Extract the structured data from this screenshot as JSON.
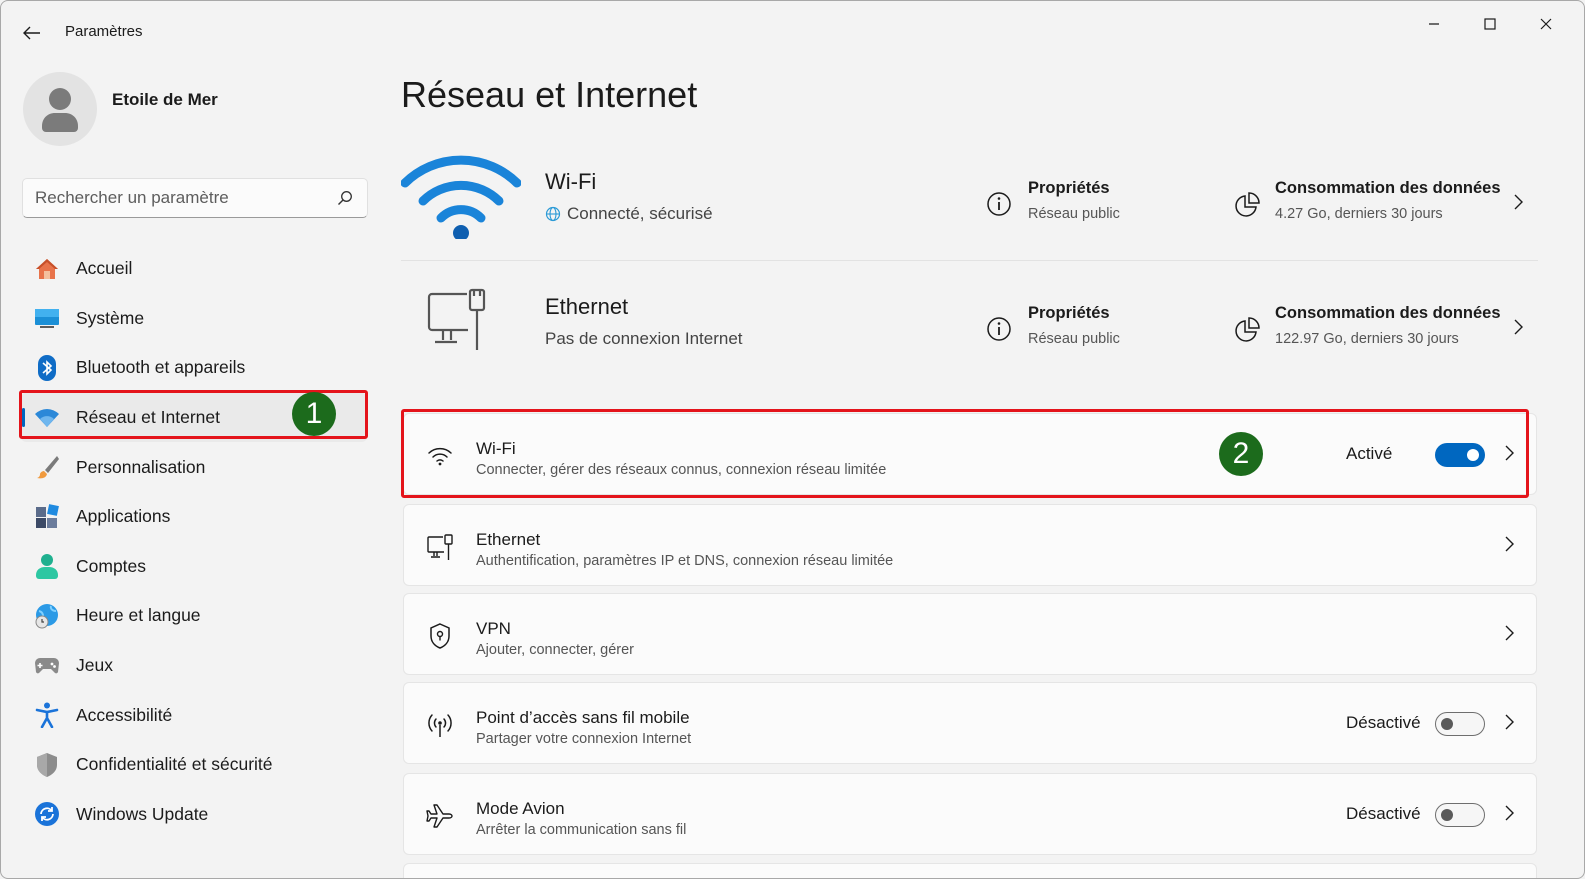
{
  "window": {
    "title": "Paramètres",
    "back_icon": "arrow-left-icon",
    "minimize_icon": "minimize-icon",
    "maximize_icon": "maximize-icon",
    "close_icon": "close-icon"
  },
  "user": {
    "name": "Etoile de Mer",
    "avatar_icon": "person-avatar-icon"
  },
  "search": {
    "placeholder": "Rechercher un paramètre",
    "value": "",
    "icon": "search-icon"
  },
  "sidebar": {
    "items": [
      {
        "label": "Accueil",
        "icon": "home-icon",
        "active": false
      },
      {
        "label": "Système",
        "icon": "system-display-icon",
        "active": false
      },
      {
        "label": "Bluetooth et appareils",
        "icon": "bluetooth-icon",
        "active": false
      },
      {
        "label": "Réseau et Internet",
        "icon": "wifi-icon",
        "active": true
      },
      {
        "label": "Personnalisation",
        "icon": "paintbrush-icon",
        "active": false
      },
      {
        "label": "Applications",
        "icon": "apps-icon",
        "active": false
      },
      {
        "label": "Comptes",
        "icon": "account-icon",
        "active": false
      },
      {
        "label": "Heure et langue",
        "icon": "globe-clock-icon",
        "active": false
      },
      {
        "label": "Jeux",
        "icon": "gamepad-icon",
        "active": false
      },
      {
        "label": "Accessibilité",
        "icon": "accessibility-icon",
        "active": false
      },
      {
        "label": "Confidentialité et sécurité",
        "icon": "shield-icon",
        "active": false
      },
      {
        "label": "Windows Update",
        "icon": "update-icon",
        "active": false
      }
    ]
  },
  "annotations": {
    "badge1": "1",
    "badge2": "2",
    "highlight_color": "#e4141b",
    "badge_color": "#1c6b1c"
  },
  "main": {
    "title": "Réseau et Internet",
    "connections": [
      {
        "name": "Wi-Fi",
        "status": "Connecté, sécurisé",
        "icon": "wifi-large-icon",
        "properties_title": "Propriétés",
        "properties_sub": "Réseau public",
        "data_title": "Consommation des données",
        "data_sub": "4.27 Go, derniers 30 jours"
      },
      {
        "name": "Ethernet",
        "status": "Pas de connexion Internet",
        "icon": "ethernet-large-icon",
        "properties_title": "Propriétés",
        "properties_sub": "Réseau public",
        "data_title": "Consommation des données",
        "data_sub": "122.97 Go, derniers 30 jours"
      }
    ],
    "cards": [
      {
        "title": "Wi-Fi",
        "subtitle": "Connecter, gérer des réseaux connus, connexion réseau limitée",
        "icon": "wifi-icon",
        "state": "Activé",
        "toggle_on": true
      },
      {
        "title": "Ethernet",
        "subtitle": "Authentification, paramètres IP et DNS, connexion réseau limitée",
        "icon": "ethernet-icon"
      },
      {
        "title": "VPN",
        "subtitle": "Ajouter, connecter, gérer",
        "icon": "vpn-shield-icon"
      },
      {
        "title": "Point d’accès sans fil mobile",
        "subtitle": "Partager votre connexion Internet",
        "icon": "hotspot-icon",
        "state": "Désactivé",
        "toggle_on": false
      },
      {
        "title": "Mode Avion",
        "subtitle": "Arrêter la communication sans fil",
        "icon": "airplane-icon",
        "state": "Désactivé",
        "toggle_on": false
      }
    ]
  },
  "colors": {
    "accent": "#0067c0",
    "background": "#f3f3f3",
    "card": "#fbfbfb"
  }
}
